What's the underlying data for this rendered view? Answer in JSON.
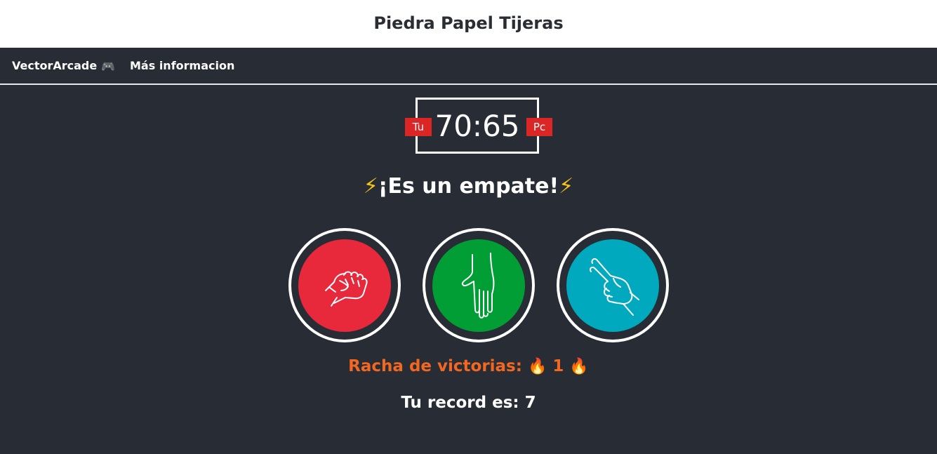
{
  "header": {
    "title": "Piedra Papel Tijeras"
  },
  "nav": {
    "brand": "VectorArcade",
    "brand_icon": "🎮",
    "info_link": "Más informacion"
  },
  "scoreboard": {
    "score": "70:65",
    "player_label": "Tu",
    "pc_label": "Pc"
  },
  "result": {
    "icon": "⚡",
    "message": "¡Es un empate!"
  },
  "choices": [
    {
      "name": "rock-icon",
      "color": "#e8283b"
    },
    {
      "name": "paper-icon",
      "color": "#009e35"
    },
    {
      "name": "scissors-icon",
      "color": "#00a9be"
    }
  ],
  "streak": {
    "label": "Racha de victorias:",
    "icon": "🔥",
    "count": "1"
  },
  "record": {
    "text": "Tu record es: 7"
  },
  "colors": {
    "background": "#282c34",
    "badge": "#dc2626",
    "streak": "#f26722"
  }
}
